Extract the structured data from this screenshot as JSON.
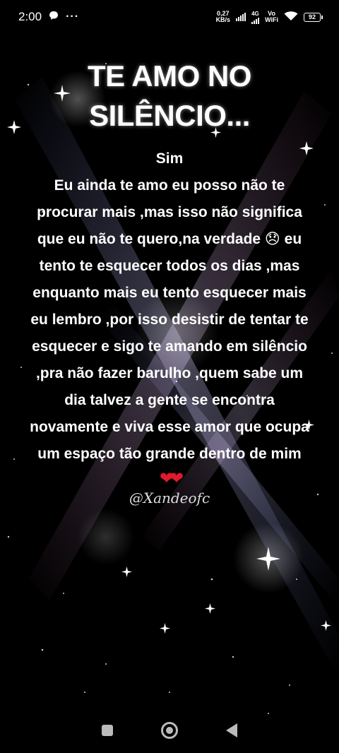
{
  "status_bar": {
    "time": "2:00",
    "net_speed_value": "0,27",
    "net_speed_unit": "KB/s",
    "network_type": "4G",
    "vo_label": "Vo",
    "wifi_label": "WiFi",
    "battery": "92"
  },
  "post": {
    "title_line1": "TE AMO NO",
    "title_line2": "SILÊNCIO...",
    "body": "Sim\nEu ainda te amo eu posso não te procurar mais ,mas isso não significa que eu não te quero,na verdade 😞 eu tento te esquecer todos os dias ,mas enquanto mais eu tento esquecer mais eu lembro ,por isso desistir de tentar te esquecer e sigo te amando em silêncio ,pra não fazer barulho ,quem sabe um dia talvez a gente se  encontra novamente e viva esse amor que ocupa um espaço tão grande dentro de mim",
    "hearts": "❤❤",
    "signature": "@Xandeofc"
  },
  "colors": {
    "background": "#000000",
    "heart": "#e0192c"
  }
}
